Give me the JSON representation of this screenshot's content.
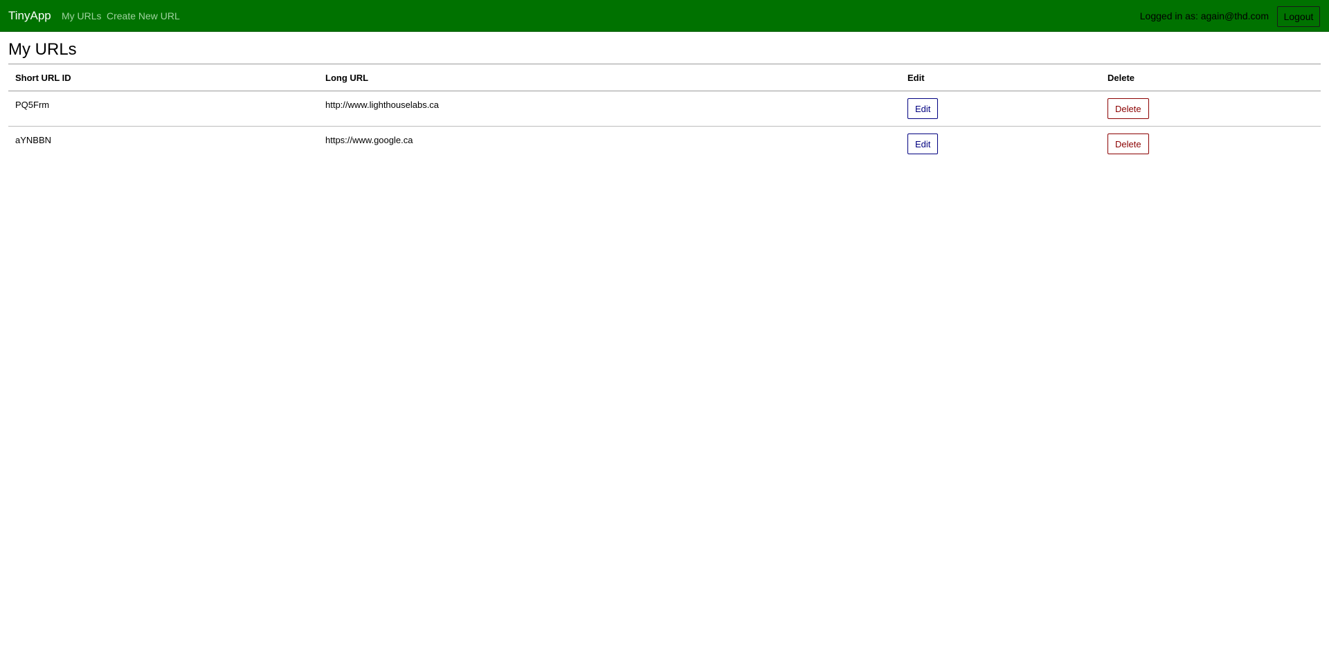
{
  "navbar": {
    "brand": "TinyApp",
    "links": [
      "My URLs",
      "Create New URL"
    ],
    "logged_in_text": "Logged in as: again@thd.com",
    "logout_label": "Logout"
  },
  "page": {
    "title": "My URLs"
  },
  "table": {
    "headers": [
      "Short URL ID",
      "Long URL",
      "Edit",
      "Delete"
    ],
    "rows": [
      {
        "short_id": "PQ5Frm",
        "long_url": "http://www.lighthouselabs.ca",
        "edit_label": "Edit",
        "delete_label": "Delete"
      },
      {
        "short_id": "aYNBBN",
        "long_url": "https://www.google.ca",
        "edit_label": "Edit",
        "delete_label": "Delete"
      }
    ]
  },
  "colors": {
    "navbar_bg": "#007200",
    "nav_link": "#9fd29f",
    "edit_accent": "#000080",
    "delete_accent": "#8b0000"
  }
}
